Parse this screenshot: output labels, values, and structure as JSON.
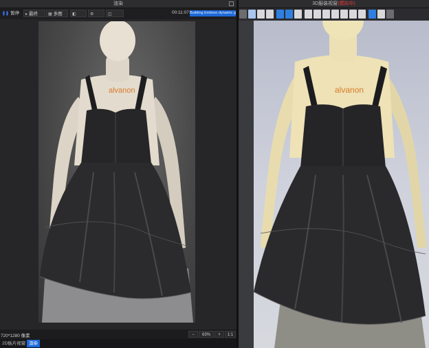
{
  "left_panel": {
    "title": "渲染",
    "toolbar": {
      "pause_label": "暂停",
      "final_label": "最终",
      "multi_label": "多图",
      "elapsed": "00:11:07",
      "status_log": "Building Embree dynamic geo"
    },
    "render": {
      "brand_text": "alvanon"
    },
    "status": {
      "resolution": "720*1280 像素",
      "zoom": "63%",
      "ratio_button": "1:1"
    },
    "tabs": [
      {
        "label": "2D板片视窗"
      },
      {
        "label": "渲染"
      }
    ]
  },
  "right_panel": {
    "title_prefix": "3D服装视窗",
    "title_status": "(模拟中)",
    "brand_text": "alvanon",
    "toolbar_icons": [
      "avatar-icon",
      "skeleton-icon",
      "fabric-icon",
      "texture-icon",
      "thickness-icon",
      "surface-icon",
      "mesh-icon",
      "strain-icon",
      "shading-icon",
      "garment-icon",
      "pattern-icon",
      "solid-icon",
      "fit-icon",
      "pose-icon",
      "flip-icon",
      "show-icon",
      "hide-icon"
    ]
  },
  "colors": {
    "accent": "#1d68d8",
    "status_red": "#e03b3b",
    "bg_dark": "#232325"
  }
}
